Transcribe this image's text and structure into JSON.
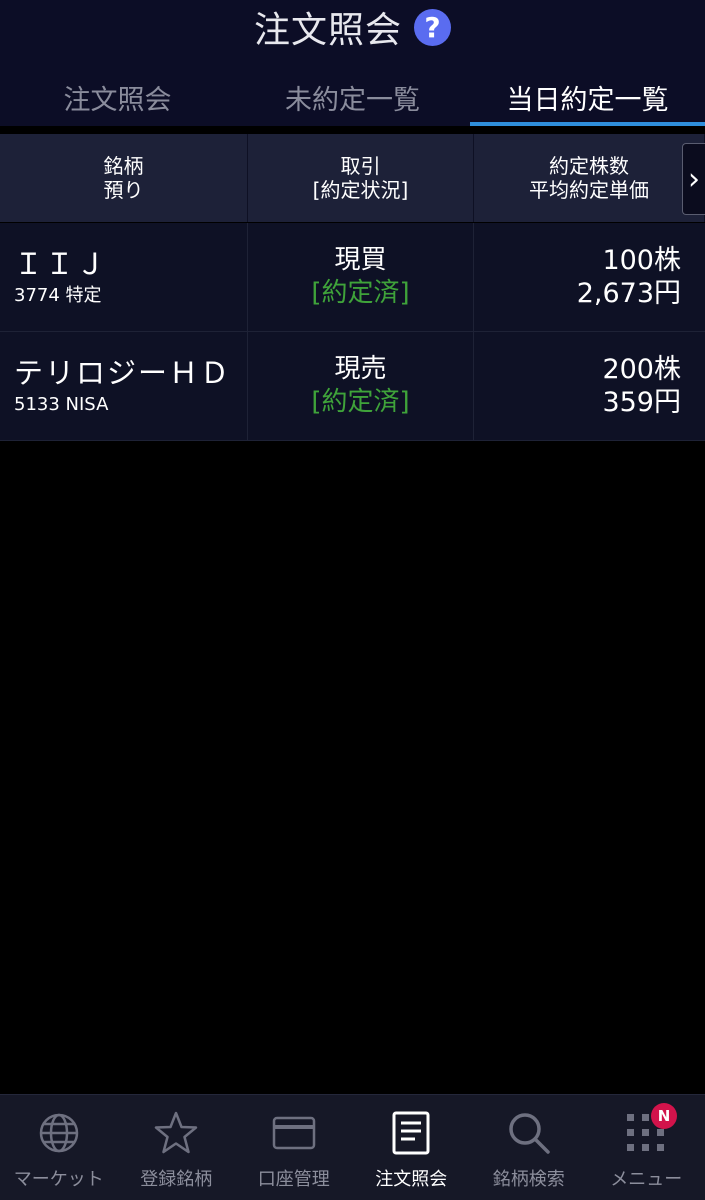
{
  "header": {
    "title": "注文照会"
  },
  "tabs": [
    {
      "label": "注文照会"
    },
    {
      "label": "未約定一覧"
    },
    {
      "label": "当日約定一覧"
    }
  ],
  "columns": {
    "c1_line1": "銘柄",
    "c1_line2": "預り",
    "c2_line1": "取引",
    "c2_line2": "[約定状況]",
    "c3_line1": "約定株数",
    "c3_line2": "平均約定単価"
  },
  "orders": [
    {
      "name": "ＩＩＪ",
      "sub": "3774 特定",
      "trade": "現買",
      "status": "[約定済]",
      "qty": "100株",
      "price": "2,673円"
    },
    {
      "name": "テリロジーＨＤ",
      "sub": "5133 NISA",
      "trade": "現売",
      "status": "[約定済]",
      "qty": "200株",
      "price": "359円"
    }
  ],
  "nav": [
    {
      "label": "マーケット"
    },
    {
      "label": "登録銘柄"
    },
    {
      "label": "口座管理"
    },
    {
      "label": "注文照会"
    },
    {
      "label": "銘柄検索"
    },
    {
      "label": "メニュー",
      "badge": "N"
    }
  ],
  "colors": {
    "accent": "#2f8fdc",
    "status_green": "#3fa33a",
    "badge": "#d2134b",
    "help": "#5a6cf0"
  }
}
